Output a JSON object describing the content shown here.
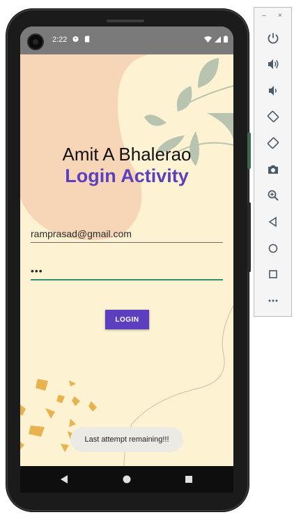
{
  "status_bar": {
    "time": "2:22"
  },
  "header": {
    "name": "Amit A Bhalerao",
    "activity": "Login Activity"
  },
  "form": {
    "email_value": "ramprasad@gmail.com",
    "password_value": "•••",
    "login_label": "LOGIN"
  },
  "toast": {
    "message": "Last attempt remaining!!!"
  },
  "colors": {
    "accent": "#5b3fbf",
    "screen_bg": "#fdf3d3",
    "blob": "#f7d6b8",
    "leaf": "#b8c3b0",
    "spots": "#e8b24e",
    "input_focus": "#2f8f6f"
  },
  "emulator_toolbar": {
    "window_controls": [
      "–",
      "×"
    ],
    "items": [
      "power-icon",
      "volume-up-icon",
      "volume-down-icon",
      "rotate-left-icon",
      "rotate-right-icon",
      "camera-icon",
      "zoom-icon",
      "back-icon",
      "home-icon",
      "overview-icon",
      "more-icon"
    ]
  },
  "navigation_bar": {
    "buttons": [
      "back-icon",
      "home-icon",
      "recents-icon"
    ]
  }
}
